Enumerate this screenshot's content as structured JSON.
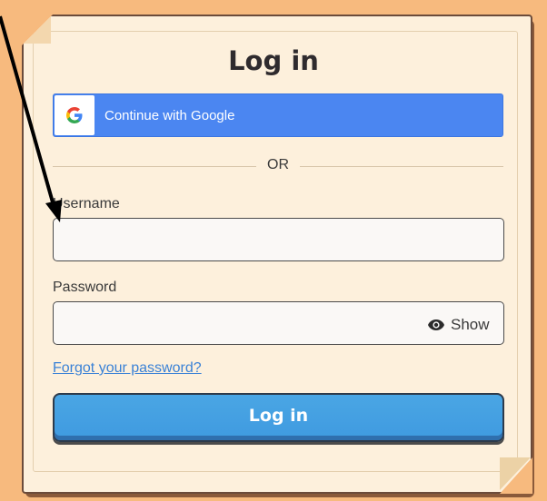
{
  "form": {
    "title": "Log in",
    "google_button_label": "Continue with Google",
    "google_letter": "G",
    "divider_text": "OR",
    "username_label": "Username",
    "username_value": "",
    "password_label": "Password",
    "password_value": "",
    "show_label": "Show",
    "forgot_link": "Forgot your password?",
    "submit_label": "Log in"
  },
  "colors": {
    "background": "#f7ba7e",
    "card": "#fdf0dc",
    "google_blue": "#4b86f1",
    "submit_blue": "#3f9ae0",
    "link": "#3b82d6"
  },
  "icons": [
    "google-g-icon",
    "eye-icon",
    "annotation-arrow"
  ]
}
